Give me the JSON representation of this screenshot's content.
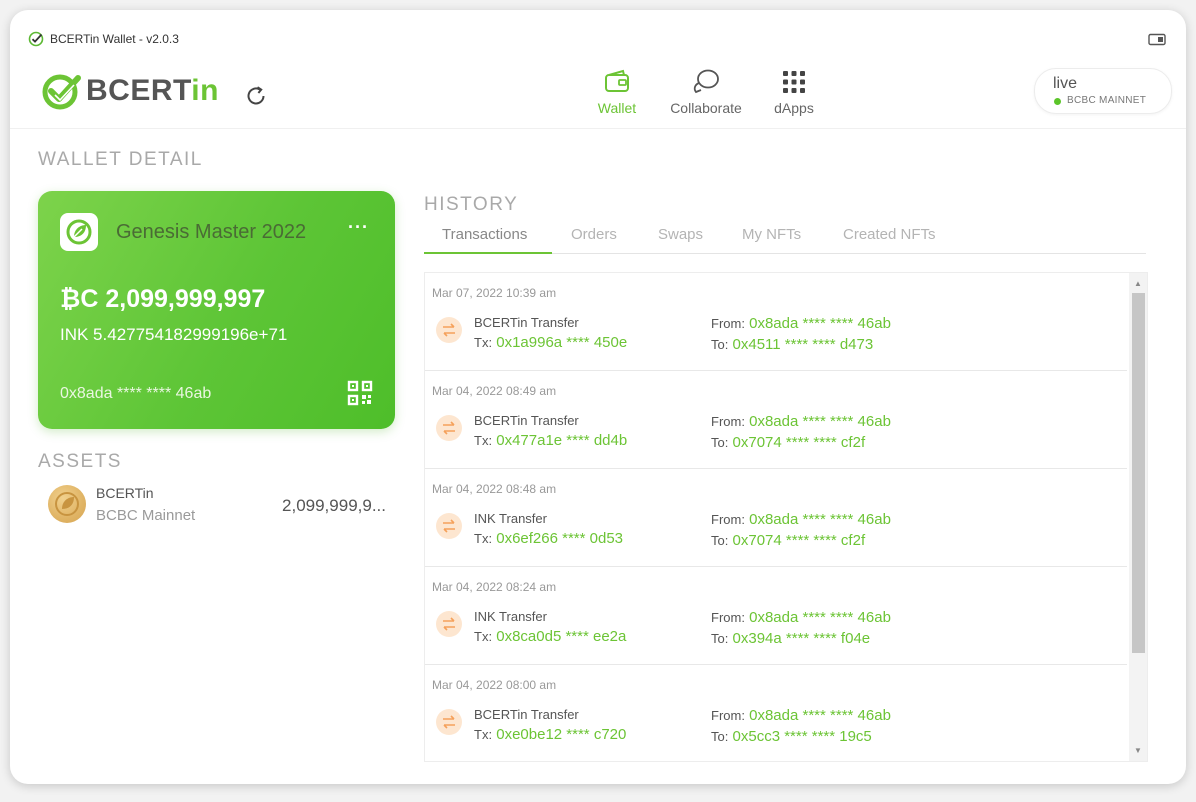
{
  "titlebar": {
    "title": "BCERTin Wallet - v2.0.3"
  },
  "header": {
    "logo_text": "BCERTin",
    "nav": [
      {
        "label": "Wallet",
        "icon": "wallet-icon",
        "active": true
      },
      {
        "label": "Collaborate",
        "icon": "chat-bubbles-icon",
        "active": false
      },
      {
        "label": "dApps",
        "icon": "grid-icon",
        "active": false
      }
    ],
    "network": {
      "status": "live",
      "name": "BCBC MAINNET",
      "status_color": "#5cc52a"
    }
  },
  "wallet_detail": {
    "title": "WALLET DETAIL",
    "card": {
      "name": "Genesis Master 2022",
      "menu": "···",
      "balance_main": "₿C 2,099,999,997",
      "balance_ink": "INK  5.427754182999196e+71",
      "address": "0x8ada **** **** 46ab"
    }
  },
  "assets": {
    "title": "ASSETS",
    "items": [
      {
        "name": "BCERTin",
        "network": "BCBC Mainnet",
        "balance": "2,099,999,9..."
      }
    ]
  },
  "history": {
    "title": "HISTORY",
    "tabs": [
      "Transactions",
      "Orders",
      "Swaps",
      "My NFTs",
      "Created NFTs"
    ],
    "active_tab": "Transactions",
    "labels": {
      "tx": "Tx:",
      "from": "From:",
      "to": "To:"
    },
    "transactions": [
      {
        "date": "Mar 07, 2022 10:39 am",
        "type": "BCERTin Transfer",
        "hash": "0x1a996a **** 450e",
        "from": "0x8ada **** **** 46ab",
        "to": "0x4511 **** **** d473"
      },
      {
        "date": "Mar 04, 2022 08:49 am",
        "type": "BCERTin Transfer",
        "hash": "0x477a1e **** dd4b",
        "from": "0x8ada **** **** 46ab",
        "to": "0x7074 **** **** cf2f"
      },
      {
        "date": "Mar 04, 2022 08:48 am",
        "type": "INK Transfer",
        "hash": "0x6ef266 **** 0d53",
        "from": "0x8ada **** **** 46ab",
        "to": "0x7074 **** **** cf2f"
      },
      {
        "date": "Mar 04, 2022 08:24 am",
        "type": "INK Transfer",
        "hash": "0x8ca0d5 **** ee2a",
        "from": "0x8ada **** **** 46ab",
        "to": "0x394a **** **** f04e"
      },
      {
        "date": "Mar 04, 2022 08:00 am",
        "type": "BCERTin Transfer",
        "hash": "0xe0be12 **** c720",
        "from": "0x8ada **** **** 46ab",
        "to": "0x5cc3 **** **** 19c5"
      }
    ]
  },
  "colors": {
    "accent": "#6cc435",
    "card_gradient_start": "#7dd34b",
    "card_gradient_end": "#4ebe2a",
    "muted": "#a9a9a9"
  }
}
